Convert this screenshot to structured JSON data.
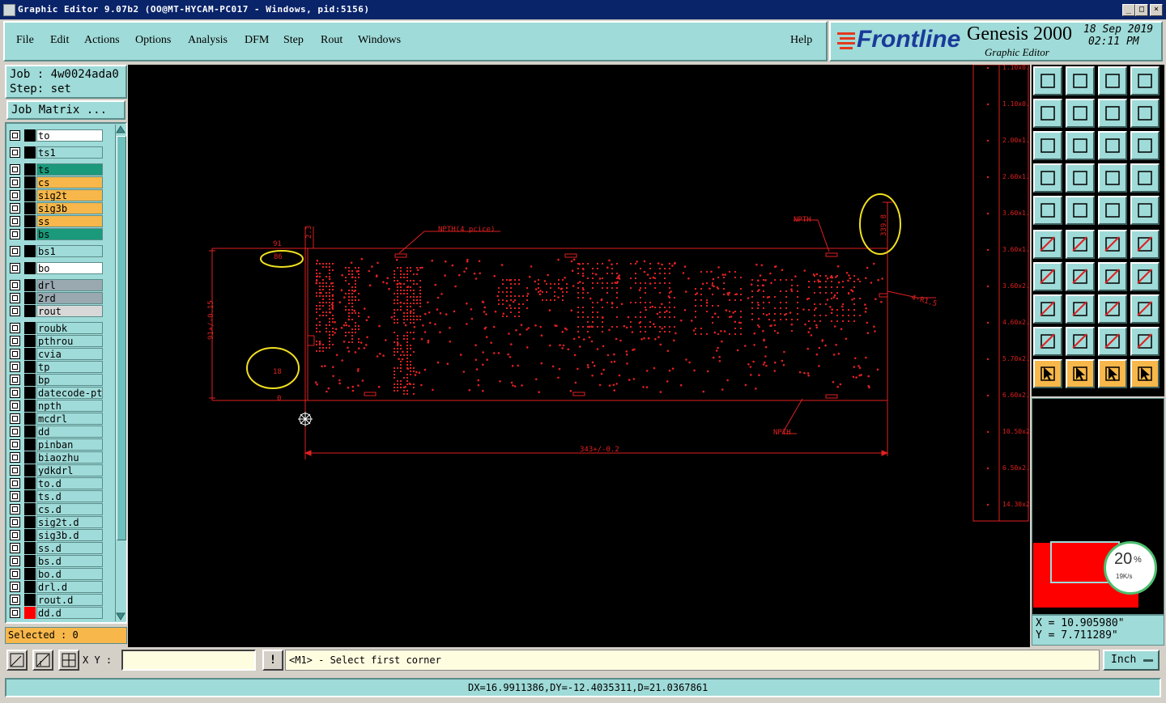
{
  "window": {
    "title": "Graphic Editor 9.07b2 (OO@MT-HYCAM-PC017 - Windows, pid:5156)"
  },
  "menu": {
    "items": [
      "File",
      "Edit",
      "Actions",
      "Options",
      "Analysis",
      "DFM",
      "Step",
      "Rout",
      "Windows"
    ],
    "help": "Help"
  },
  "brand": {
    "logo": "Frontline",
    "product": "Genesis 2000",
    "subtitle": "Graphic Editor",
    "date": "18 Sep 2019",
    "time": "02:11 PM"
  },
  "job": {
    "job_line": "Job : 4w0024ada0",
    "step_line": "Step: set",
    "matrix_button": "Job Matrix ..."
  },
  "layers": [
    {
      "name": "to",
      "color": "#ffffff",
      "swatch": "#000000"
    },
    {
      "name": "ts1",
      "color": "#9fdbd8",
      "swatch": "#000000"
    },
    {
      "name": "ts",
      "color": "#1a9a7a",
      "swatch": "#000000"
    },
    {
      "name": "cs",
      "color": "#f7b74a",
      "swatch": "#000000"
    },
    {
      "name": "sig2t",
      "color": "#f7b74a",
      "swatch": "#000000"
    },
    {
      "name": "sig3b",
      "color": "#f7b74a",
      "swatch": "#000000"
    },
    {
      "name": "ss",
      "color": "#f7b74a",
      "swatch": "#000000"
    },
    {
      "name": "bs",
      "color": "#1a9a7a",
      "swatch": "#000000"
    },
    {
      "name": "bs1",
      "color": "#9fdbd8",
      "swatch": "#000000"
    },
    {
      "name": "bo",
      "color": "#ffffff",
      "swatch": "#000000"
    },
    {
      "name": "drl",
      "color": "#9aa8b0",
      "swatch": "#000000"
    },
    {
      "name": "2rd",
      "color": "#9aa8b0",
      "swatch": "#000000"
    },
    {
      "name": "rout",
      "color": "#d8d8d8",
      "swatch": "#000000"
    },
    {
      "name": "roubk",
      "color": "#9fdbd8",
      "swatch": "#000000"
    },
    {
      "name": "pthrou",
      "color": "#9fdbd8",
      "swatch": "#000000"
    },
    {
      "name": "cvia",
      "color": "#9fdbd8",
      "swatch": "#000000"
    },
    {
      "name": "tp",
      "color": "#9fdbd8",
      "swatch": "#000000"
    },
    {
      "name": "bp",
      "color": "#9fdbd8",
      "swatch": "#000000"
    },
    {
      "name": "datecode-pte",
      "color": "#9fdbd8",
      "swatch": "#000000"
    },
    {
      "name": "npth",
      "color": "#9fdbd8",
      "swatch": "#000000"
    },
    {
      "name": "mcdrl",
      "color": "#9fdbd8",
      "swatch": "#000000"
    },
    {
      "name": "dd",
      "color": "#9fdbd8",
      "swatch": "#000000"
    },
    {
      "name": "pinban",
      "color": "#9fdbd8",
      "swatch": "#000000"
    },
    {
      "name": "biaozhu",
      "color": "#9fdbd8",
      "swatch": "#000000"
    },
    {
      "name": "ydkdrl",
      "color": "#9fdbd8",
      "swatch": "#000000"
    },
    {
      "name": "to.d",
      "color": "#9fdbd8",
      "swatch": "#000000"
    },
    {
      "name": "ts.d",
      "color": "#9fdbd8",
      "swatch": "#000000"
    },
    {
      "name": "cs.d",
      "color": "#9fdbd8",
      "swatch": "#000000"
    },
    {
      "name": "sig2t.d",
      "color": "#9fdbd8",
      "swatch": "#000000"
    },
    {
      "name": "sig3b.d",
      "color": "#9fdbd8",
      "swatch": "#000000"
    },
    {
      "name": "ss.d",
      "color": "#9fdbd8",
      "swatch": "#000000"
    },
    {
      "name": "bs.d",
      "color": "#9fdbd8",
      "swatch": "#000000"
    },
    {
      "name": "bo.d",
      "color": "#9fdbd8",
      "swatch": "#000000"
    },
    {
      "name": "drl.d",
      "color": "#9fdbd8",
      "swatch": "#000000"
    },
    {
      "name": "rout.d",
      "color": "#9fdbd8",
      "swatch": "#000000"
    },
    {
      "name": "dd.d",
      "color": "#9fdbd8",
      "swatch": "#ff0000"
    }
  ],
  "selected": "Selected : 0",
  "canvas": {
    "labels": {
      "npth_top": "NPTH(4 pcice)",
      "npth_right": "NPTH",
      "npth_bottom": "NPTH",
      "dim_width": "343+/-0.2",
      "dim_height": "91+/-0.15",
      "dim_339": "339.8",
      "dim_r": "4-R1.5",
      "dim_91": "91",
      "dim_86": "86",
      "dim_23": "2.3",
      "dim_18": "18",
      "dim_0": "0"
    },
    "table_rows": [
      "1.10x0.9",
      "1.10x0.9",
      "2.00x1.2",
      "2.60x1.4",
      "3.60x1.6",
      "3.60x1.6",
      "3.60x2.7",
      "4.60x2.7",
      "5.70x2.7",
      "6.60x2.7",
      "10.50x2.7",
      "6.50x2.7",
      "14.30x2.7"
    ]
  },
  "preview": {
    "percent": "20",
    "percent_sign": "%",
    "rate": "19K/s"
  },
  "coords": {
    "x": "X = 10.905980\"",
    "y": "Y = 7.711289\""
  },
  "input": {
    "xy_label": "X Y :",
    "xy_value": "",
    "prompt": "<M1> - Select first corner",
    "units": "Inch"
  },
  "status": {
    "text": "DX=16.9911386,DY=-12.4035311,D=21.0367861"
  }
}
